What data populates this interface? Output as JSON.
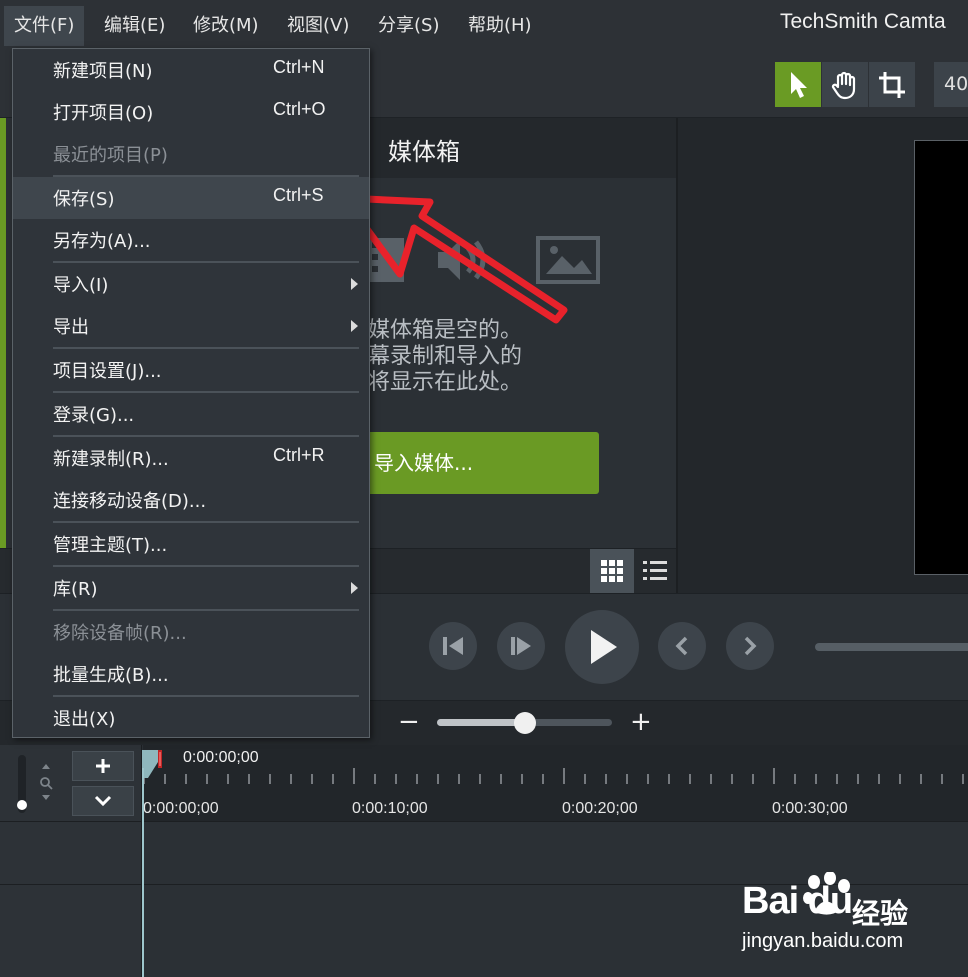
{
  "menubar": {
    "items": [
      {
        "label": "文件(F)"
      },
      {
        "label": "编辑(E)"
      },
      {
        "label": "修改(M)"
      },
      {
        "label": "视图(V)"
      },
      {
        "label": "分享(S)"
      },
      {
        "label": "帮助(H)"
      }
    ],
    "app_title": "TechSmith Camta"
  },
  "toolbar": {
    "zoom_value": "40",
    "tools": [
      "select-icon",
      "hand-icon",
      "crop-icon"
    ]
  },
  "file_menu": {
    "items": [
      {
        "label": "新建项目(N)",
        "shortcut": "Ctrl+N"
      },
      {
        "label": "打开项目(O)",
        "shortcut": "Ctrl+O"
      },
      {
        "label": "最近的项目(P)",
        "shortcut": ""
      },
      {
        "label": "保存(S)",
        "shortcut": "Ctrl+S"
      },
      {
        "label": "另存为(A)...",
        "shortcut": ""
      },
      {
        "label": "导入(I)",
        "shortcut": ""
      },
      {
        "label": "导出",
        "shortcut": ""
      },
      {
        "label": "项目设置(J)...",
        "shortcut": ""
      },
      {
        "label": "登录(G)...",
        "shortcut": ""
      },
      {
        "label": "新建录制(R)...",
        "shortcut": "Ctrl+R"
      },
      {
        "label": "连接移动设备(D)...",
        "shortcut": ""
      },
      {
        "label": "管理主题(T)...",
        "shortcut": ""
      },
      {
        "label": "库(R)",
        "shortcut": ""
      },
      {
        "label": "移除设备帧(R)...",
        "shortcut": ""
      },
      {
        "label": "批量生成(B)...",
        "shortcut": ""
      },
      {
        "label": "退出(X)",
        "shortcut": ""
      }
    ]
  },
  "media_bin": {
    "title": "媒体箱",
    "empty_line1": "媒体箱是空的。",
    "empty_line2": "幕录制和导入的",
    "empty_line3": "将显示在此处。",
    "import_button": "导入媒体..."
  },
  "timeline": {
    "playhead_time": "0:00:00;00",
    "ticks": [
      "0:00:00;00",
      "0:00:10;00",
      "0:00:20;00",
      "0:00:30;00"
    ]
  },
  "watermark": {
    "logo": "Bai du",
    "brand": "经验",
    "url": "jingyan.baidu.com"
  },
  "colors": {
    "accent_green": "#6a9b24",
    "annotation_arrow": "#e8222b"
  }
}
